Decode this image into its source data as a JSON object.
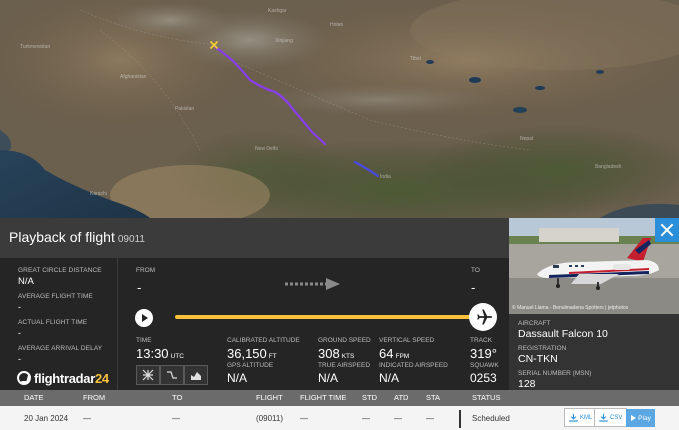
{
  "panel": {
    "title": "Playback of flight",
    "flight_number": "09011"
  },
  "stats": {
    "great_circle_distance": {
      "label": "GREAT CIRCLE DISTANCE",
      "value": "N/A"
    },
    "average_flight_time": {
      "label": "AVERAGE FLIGHT TIME",
      "value": "-"
    },
    "actual_flight_time": {
      "label": "ACTUAL FLIGHT TIME",
      "value": "-"
    },
    "average_arrival_delay": {
      "label": "AVERAGE ARRIVAL DELAY",
      "value": "-"
    }
  },
  "route": {
    "from_label": "FROM",
    "from_value": "-",
    "to_label": "TO",
    "to_value": "-",
    "progress": 1.0
  },
  "telemetry": {
    "time": {
      "label": "TIME",
      "value": "13:30",
      "unit": "UTC"
    },
    "calibrated_altitude": {
      "label": "CALIBRATED ALTITUDE",
      "value": "36,150",
      "unit": "FT"
    },
    "gps_altitude": {
      "label": "GPS ALTITUDE",
      "value": "N/A"
    },
    "ground_speed": {
      "label": "GROUND SPEED",
      "value": "308",
      "unit": "KTS"
    },
    "true_airspeed": {
      "label": "TRUE AIRSPEED",
      "value": "N/A"
    },
    "vertical_speed": {
      "label": "VERTICAL SPEED",
      "value": "64",
      "unit": "FPM"
    },
    "indicated_airspeed": {
      "label": "INDICATED AIRSPEED",
      "value": "N/A"
    },
    "track": {
      "label": "TRACK",
      "value": "319°"
    },
    "squawk": {
      "label": "SQUAWK",
      "value": "0253"
    }
  },
  "logo": {
    "part1": "flightradar",
    "part2": "24"
  },
  "aircraft": {
    "photo_credit": "© Manuel Llama - Benalmadena Spotters | jetphotos",
    "aircraft_label": "AIRCRAFT",
    "aircraft_value": "Dassault Falcon 10",
    "registration_label": "REGISTRATION",
    "registration_value": "CN-TKN",
    "serial_label": "SERIAL NUMBER (MSN)",
    "serial_value": "128"
  },
  "table": {
    "headers": [
      "DATE",
      "FROM",
      "TO",
      "FLIGHT",
      "FLIGHT TIME",
      "STD",
      "ATD",
      "STA",
      "STATUS"
    ],
    "row": {
      "date": "20 Jan 2024",
      "from": "—",
      "to": "—",
      "flight": "(09011)",
      "flight_time": "—",
      "std": "—",
      "atd": "—",
      "sta": "—",
      "status": "Scheduled"
    },
    "kml_label": "KML",
    "csv_label": "CSV",
    "play_label": "Play"
  },
  "colors": {
    "track_line": "#f7c23a",
    "flight_path": "#8a3cf0",
    "accent_blue": "#2a8ed9"
  },
  "icons": [
    "play-icon",
    "plane-icon",
    "close-icon",
    "download-icon",
    "map-tool-icon",
    "route-tool-icon",
    "chart-tool-icon"
  ]
}
